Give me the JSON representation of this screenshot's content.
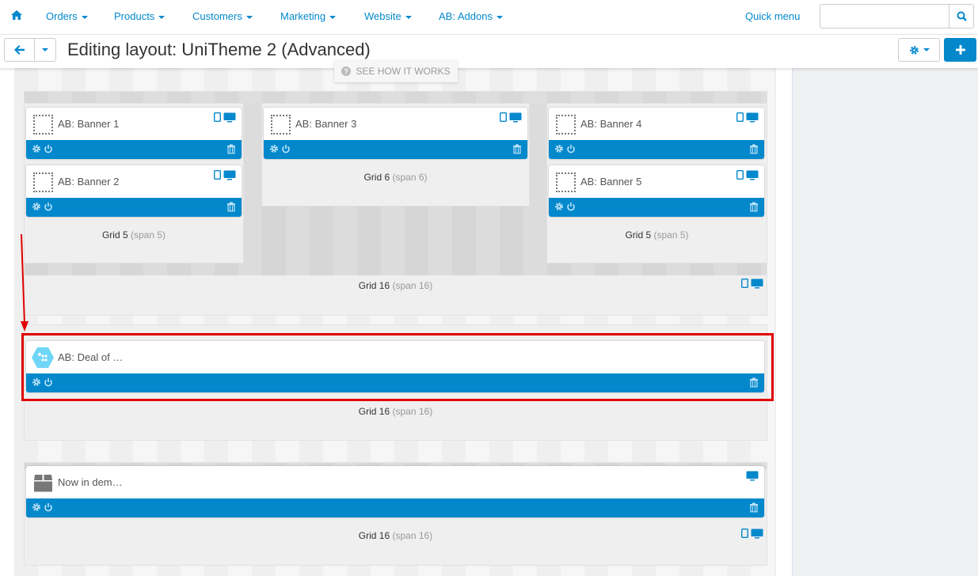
{
  "nav": {
    "home_icon": "home-icon",
    "items": [
      "Orders",
      "Products",
      "Customers",
      "Marketing",
      "Website",
      "AB: Addons"
    ],
    "quick_menu": "Quick menu",
    "search_placeholder": ""
  },
  "toolbar": {
    "title": "Editing layout: UniTheme 2 (Advanced)",
    "see_how": "SEE HOW IT WORKS"
  },
  "colors": {
    "accent": "#0388cc",
    "highlight": "#e00000"
  },
  "containers": [
    {
      "label": "Grid 16",
      "span": "(span 16)",
      "grids": [
        {
          "label": "Grid 5",
          "span": "(span 5)",
          "blocks": [
            "AB: Banner 1",
            "AB: Banner 2"
          ]
        },
        {
          "label": "Grid 6",
          "span": "(span 6)",
          "blocks": [
            "AB: Banner 3"
          ]
        },
        {
          "label": "Grid 5",
          "span": "(span 5)",
          "blocks": [
            "AB: Banner 4",
            "AB: Banner 5"
          ]
        }
      ]
    },
    {
      "label": "Grid 16",
      "span": "(span 16)",
      "blocks": [
        "AB: Deal of …"
      ]
    },
    {
      "label": "Grid 16",
      "span": "(span 16)",
      "blocks": [
        "Now in dem…"
      ]
    }
  ]
}
